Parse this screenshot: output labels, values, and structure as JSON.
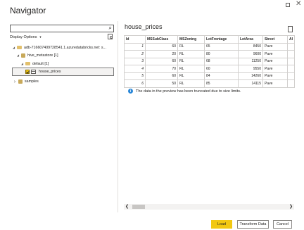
{
  "window": {
    "title": "Navigator"
  },
  "left": {
    "search_value": "",
    "display_options_label": "Display Options",
    "tree": [
      {
        "label": "adb-716607409728541.1.azuredatabricks.net: s..."
      },
      {
        "label": "hive_metastore [1]"
      },
      {
        "label": "default [1]"
      },
      {
        "label": "house_prices"
      },
      {
        "label": "samples"
      }
    ]
  },
  "preview": {
    "title": "house_prices",
    "columns": [
      "Id",
      "MSSubClass",
      "MSZoning",
      "LotFrontage",
      "LotArea",
      "Street",
      "Al"
    ],
    "rows": [
      [
        "1",
        "60",
        "RL",
        "65",
        "8450",
        "Pave",
        ""
      ],
      [
        "2",
        "20",
        "RL",
        "80",
        "9600",
        "Pave",
        ""
      ],
      [
        "3",
        "60",
        "RL",
        "68",
        "11250",
        "Pave",
        ""
      ],
      [
        "4",
        "70",
        "RL",
        "60",
        "9550",
        "Pave",
        ""
      ],
      [
        "5",
        "60",
        "RL",
        "84",
        "14260",
        "Pave",
        ""
      ],
      [
        "6",
        "50",
        "RL",
        "85",
        "14115",
        "Pave",
        ""
      ]
    ],
    "info_text": "The data in the preview has been truncated due to size limits."
  },
  "buttons": {
    "load": "Load",
    "transform": "Transform Data",
    "cancel": "Cancel"
  },
  "colors": {
    "accent": "#f2c811",
    "info": "#2b88d8"
  }
}
